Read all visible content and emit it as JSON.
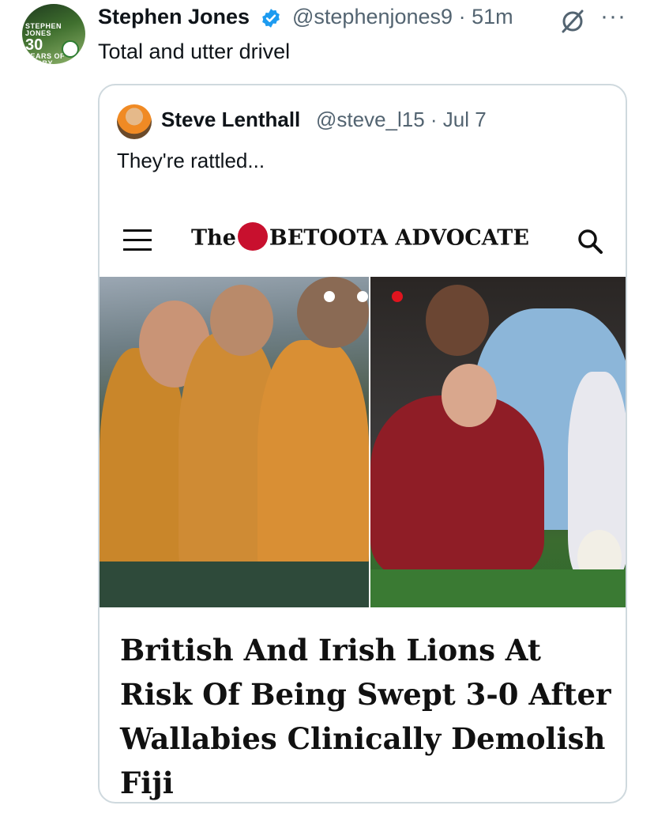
{
  "tweet": {
    "author_name": "Stephen Jones",
    "handle": "@stephenjones9",
    "separator": "·",
    "time": "51m",
    "text": "Total and utter drivel",
    "avatar_text_small": "STEPHEN JONES",
    "avatar_text_big": "30",
    "avatar_text_bottom": "YEARS OF RUGBY",
    "verified_icon": "verified-badge-icon",
    "more_label": "···"
  },
  "quoted": {
    "author_name": "Steve Lenthall",
    "handle": "@steve_l15",
    "date": "Jul 7",
    "handle_line": "@steve_l15 · Jul 7",
    "text": "They're rattled..."
  },
  "article": {
    "site_prefix": "The",
    "site_name": "BETOOTA ADVOCATE",
    "headline": "British And Irish Lions At Risk Of Being Swept 3-0 After Wallabies Clinically Demolish Fiji",
    "image_left_alt": "Wallabies players celebrating in gold jerseys",
    "image_right_alt": "Lions player tackled by Fiji player in light blue jersey"
  },
  "colors": {
    "accent_blue": "#1d9bf0",
    "text_primary": "#0f1419",
    "text_secondary": "#536471",
    "border": "#cfd9de",
    "brand_red": "#c8102e"
  }
}
